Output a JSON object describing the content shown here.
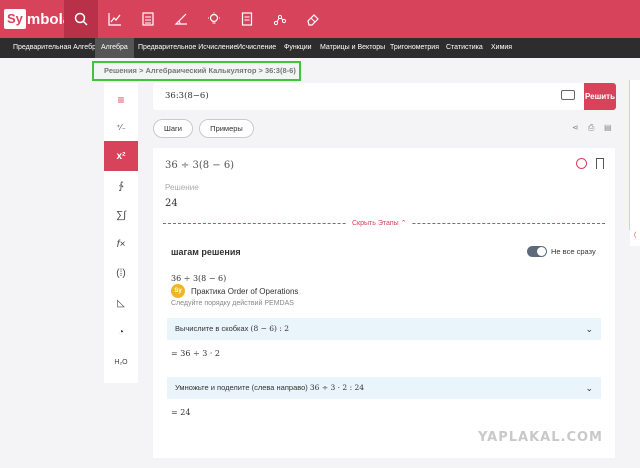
{
  "app": {
    "logo_box": "Sy",
    "logo_rest": "mbolab"
  },
  "top_icons": [
    "search-icon",
    "chart-icon",
    "calculator-icon",
    "angle-icon",
    "bulb-icon",
    "notebook-icon",
    "graph-icon",
    "eraser-icon"
  ],
  "nav": {
    "items": [
      "Предварительная Алгебра",
      "Алгебра",
      "Предварительное Исчисление",
      "Исчисление",
      "Функции",
      "Матрицы и Векторы",
      "Тригонометрия",
      "Статистика",
      "Химия"
    ],
    "active_index": 1
  },
  "breadcrumb": "Решения > Алгебраический Калькулятор > 36:3(8-6)",
  "left_toolbar": {
    "items": [
      "menu-icon",
      "matrix-icon",
      "exponent-icon",
      "integral-sign-icon",
      "sum-icon",
      "function-icon",
      "parentheses-icon",
      "triangle-icon",
      "pie-icon",
      "chem-icon"
    ],
    "active_index": 2,
    "labels": [
      "≡",
      "⁺⁄₋",
      "x²",
      "∱",
      "∑∫",
      "f×",
      "(⁞)",
      "◺",
      "◔",
      "H₂O"
    ]
  },
  "input": {
    "value": "36:3(8−6)",
    "solve_label": "Решить"
  },
  "pills": {
    "steps": "Шаги",
    "examples": "Примеры"
  },
  "result": {
    "expression": "36 ÷ 3(8 − 6)",
    "solution_label": "Решение",
    "solution_value": "24",
    "hide_steps": "Скрыть Этапы"
  },
  "steps": {
    "title": "шагам решения",
    "toggle_label": "Не все сразу",
    "expr": "36 ÷ 3(8 − 6)",
    "pemdas": "Следуйте порядку действий PEMDAS",
    "step1_text": "Вычислите в скобках",
    "step1_math": "(8 − 6) :  2",
    "step1_result": "= 36 ÷ 3 · 2",
    "step2_text": "Умножьте и поделите (слева направо)",
    "step2_math": "36 ÷ 3 · 2 :  24",
    "step2_result": "= 24"
  },
  "practice": {
    "badge": "Sy",
    "text": "Практика Order of Operations"
  },
  "watermark": "YAPLAKAL.COM",
  "colors": {
    "brand": "#d8435c",
    "nav_bg": "#2d2d2d",
    "highlight": "#3ec63a",
    "step_bg": "#eaf4fb"
  }
}
